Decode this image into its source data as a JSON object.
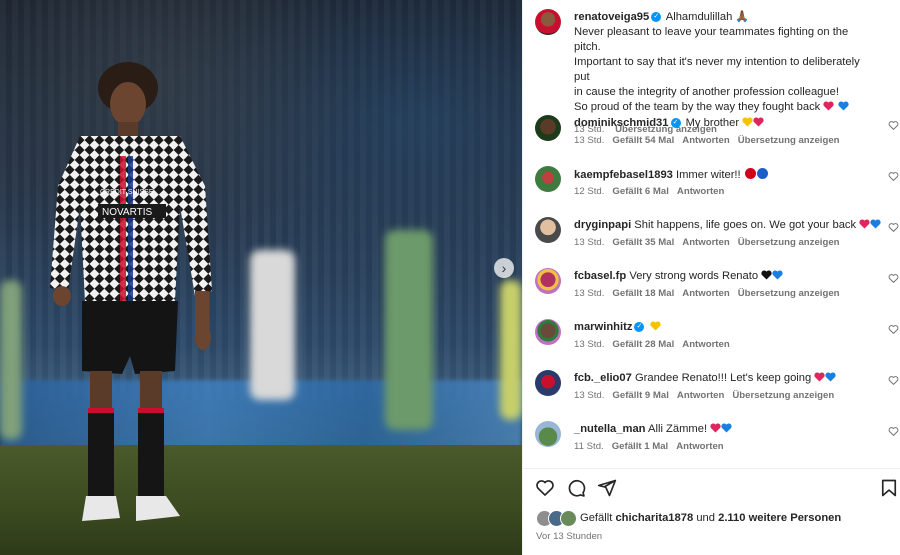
{
  "post": {
    "author": "renatoveiga95",
    "caption_lines": [
      "Alhamdulillah 🙏🏾",
      "Never pleasant to leave your teammates fighting on the pitch.",
      "Important to say that it's never my intention to deliberately put",
      "in cause the integrity of another profession colleague!",
      "So proud of the team by the way they fought back"
    ],
    "time": "13 Std.",
    "translate_label": "Übersetzung anzeigen"
  },
  "comments": [
    {
      "user": "dominikschmid31",
      "verified": true,
      "text": "My brother",
      "time": "13 Std.",
      "likes": "Gefällt 54 Mal",
      "reply": "Antworten",
      "translate": "Übersetzung anzeigen",
      "emojis": [
        "#f5c400",
        "#e0245e"
      ]
    },
    {
      "user": "kaempfebasel1893",
      "verified": false,
      "text": "Immer witer!!",
      "time": "12 Std.",
      "likes": "Gefällt 6 Mal",
      "reply": "Antworten",
      "translate": "",
      "emojis": [
        "#d0021b",
        "#1a5fc8"
      ]
    },
    {
      "user": "dryginpapi",
      "verified": false,
      "text": "Shit happens, life goes on. We got your back",
      "time": "13 Std.",
      "likes": "Gefällt 35 Mal",
      "reply": "Antworten",
      "translate": "Übersetzung anzeigen",
      "emojis": [
        "#e0245e",
        "#1a7fe0"
      ]
    },
    {
      "user": "fcbasel.fp",
      "verified": false,
      "text": "Very strong words Renato",
      "time": "13 Std.",
      "likes": "Gefällt 18 Mal",
      "reply": "Antworten",
      "translate": "Übersetzung anzeigen",
      "emojis": [
        "#111111",
        "#1a7fe0"
      ]
    },
    {
      "user": "marwinhitz",
      "verified": true,
      "text": "",
      "time": "13 Std.",
      "likes": "Gefällt 28 Mal",
      "reply": "Antworten",
      "translate": "",
      "emojis": [
        "#f5c400"
      ]
    },
    {
      "user": "fcb._elio07",
      "verified": false,
      "text": "Grandee Renato!!! Let's keep going",
      "time": "13 Std.",
      "likes": "Gefällt 9 Mal",
      "reply": "Antworten",
      "translate": "Übersetzung anzeigen",
      "emojis": [
        "#e0245e",
        "#1a7fe0"
      ]
    },
    {
      "user": "_nutella_man",
      "verified": false,
      "text": "Alli Zämme!",
      "time": "11 Std.",
      "likes": "Gefällt 1 Mal",
      "reply": "Antworten",
      "translate": "",
      "emojis": [
        "#e0245e",
        "#1a7fe0"
      ]
    }
  ],
  "likes": {
    "prefix": "Gefällt",
    "user": "chicharita1878",
    "and": "und",
    "others": "2.110 weitere Personen"
  },
  "posted_ago": "Vor 13 Stunden",
  "colors": {
    "accent": "#0095f6",
    "muted": "#737373",
    "text": "#262626"
  },
  "icons": [
    "chevron-right-icon",
    "heart-icon",
    "comment-icon",
    "share-icon",
    "bookmark-icon"
  ]
}
